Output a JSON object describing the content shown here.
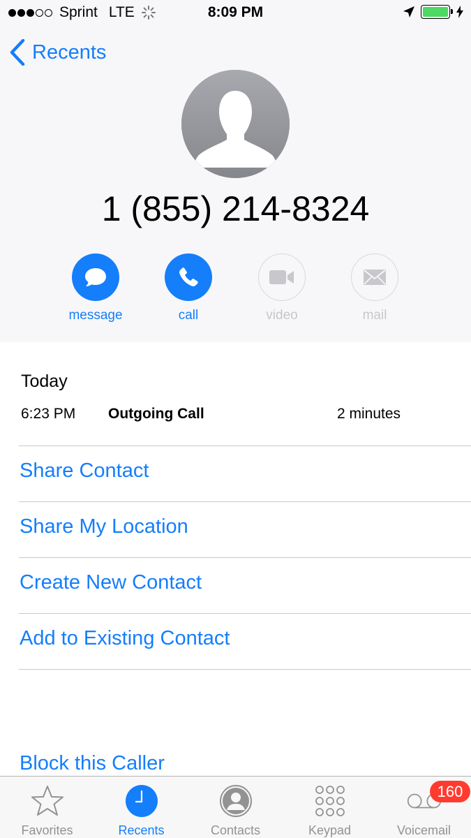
{
  "status_bar": {
    "carrier": "Sprint",
    "network": "LTE",
    "time": "8:09 PM"
  },
  "nav": {
    "back_label": "Recents"
  },
  "contact": {
    "phone_number": "1 (855) 214-8324"
  },
  "actions": [
    {
      "label": "message",
      "enabled": true
    },
    {
      "label": "call",
      "enabled": true
    },
    {
      "label": "video",
      "enabled": false
    },
    {
      "label": "mail",
      "enabled": false
    }
  ],
  "history": {
    "section_title": "Today",
    "entries": [
      {
        "time": "6:23 PM",
        "type": "Outgoing Call",
        "duration": "2 minutes"
      }
    ]
  },
  "links": {
    "share_contact": "Share Contact",
    "share_location": "Share My Location",
    "create_contact": "Create New Contact",
    "add_existing": "Add to Existing Contact",
    "block_caller": "Block this Caller"
  },
  "tab_bar": {
    "tabs": [
      {
        "label": "Favorites",
        "icon": "star-icon"
      },
      {
        "label": "Recents",
        "icon": "clock-icon",
        "active": true
      },
      {
        "label": "Contacts",
        "icon": "person-icon"
      },
      {
        "label": "Keypad",
        "icon": "keypad-icon"
      },
      {
        "label": "Voicemail",
        "icon": "voicemail-icon"
      }
    ],
    "voicemail_badge": "160"
  },
  "colors": {
    "accent": "#147efb",
    "badge": "#ff3b30",
    "battery": "#4cd964"
  }
}
